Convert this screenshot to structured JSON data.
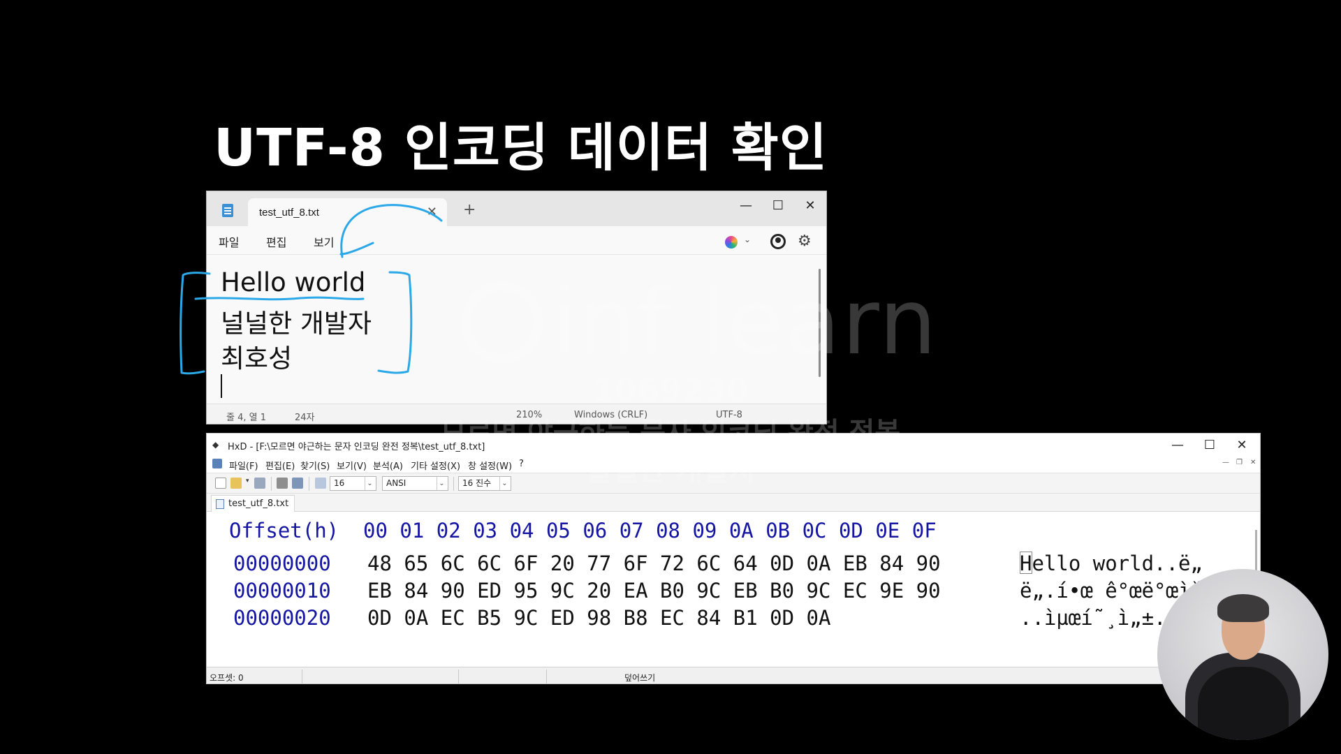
{
  "slide": {
    "title": "UTF-8 인코딩 데이터 확인"
  },
  "notepad": {
    "tab_title": "test_utf_8.txt",
    "tab_close": "✕",
    "new_tab": "+",
    "window_controls": {
      "minimize": "—",
      "maximize": "☐",
      "close": "✕"
    },
    "menu": [
      "파일",
      "편집",
      "보기"
    ],
    "icons": {
      "copilot": "copilot-icon",
      "account": "account-icon",
      "settings": "gear-icon"
    },
    "copilot_chevron": "⌄",
    "settings_glyph": "⚙",
    "content_lines": [
      "Hello world",
      "널널한 개발자",
      "최호성"
    ],
    "status": {
      "position": "줄 4, 열 1",
      "chars": "24자",
      "zoom": "210%",
      "line_ending": "Windows (CRLF)",
      "encoding": "UTF-8"
    }
  },
  "hxd": {
    "title": "HxD - [F:\\모르면 야근하는 문자 인코딩 완전 정복\\test_utf_8.txt]",
    "window_controls": {
      "minimize": "—",
      "maximize": "☐",
      "close": "✕"
    },
    "mdi_controls": [
      "—",
      "❐",
      "✕"
    ],
    "menu": [
      "파일(F)",
      "편집(E)",
      "찾기(S)",
      "보기(V)",
      "분석(A)",
      "기타 설정(X)",
      "창 설정(W)",
      "?"
    ],
    "toolbar": {
      "bytes_per_row": "16",
      "charset": "ANSI",
      "offset_base": "16 진수"
    },
    "file_tab": "test_utf_8.txt",
    "header": "Offset(h)  00 01 02 03 04 05 06 07 08 09 0A 0B 0C 0D 0E 0F",
    "rows": [
      {
        "offset": "00000000",
        "bytes": "48 65 6C 6C 6F 20 77 6F 72 6C 64 0D 0A EB 84 90",
        "text": "Hello world..ë„"
      },
      {
        "offset": "00000010",
        "bytes": "EB 84 90 ED 95 9C 20 EA B0 9C EB B0 9C EC 9E 90",
        "text": "ë„.í•œ ê°œë°œìž"
      },
      {
        "offset": "00000020",
        "bytes": "0D 0A EC B5 9C ED 98 B8 EC 84 B1 0D 0A",
        "text": "..ìµœí˜¸ì„±.."
      }
    ],
    "status": {
      "offset": "오프셋: 0",
      "mode": "덮어쓰기"
    }
  },
  "watermark": {
    "logo": "inf learn",
    "id": "1069230",
    "course": "모르면 야근하는 문자 인코딩 완전 정복",
    "author": "널널한 개발자"
  },
  "colors": {
    "annotation": "#2ba8e8",
    "hex_offset_blue": "#1515a3",
    "background": "#000000"
  }
}
